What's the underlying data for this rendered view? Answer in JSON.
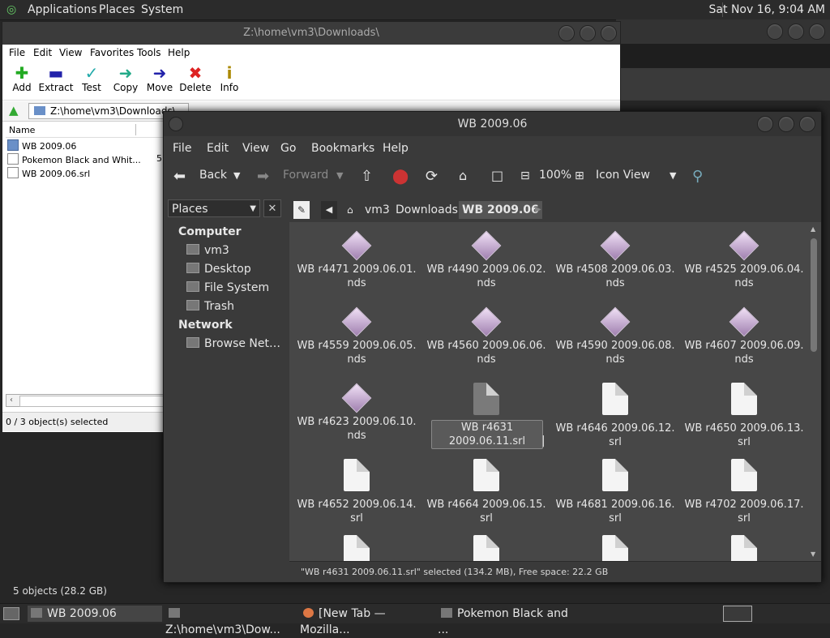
{
  "top_panel": {
    "menus": [
      "Applications",
      "Places",
      "System"
    ],
    "clock": "Sat Nov 16,  9:04 AM"
  },
  "zip_window": {
    "title": "Z:\\home\\vm3\\Downloads\\",
    "menus": [
      "File",
      "Edit",
      "View",
      "Favorites",
      "Tools",
      "Help"
    ],
    "toolbar": [
      {
        "label": "Add",
        "icon": "add-icon"
      },
      {
        "label": "Extract",
        "icon": "extract-icon"
      },
      {
        "label": "Test",
        "icon": "test-icon"
      },
      {
        "label": "Copy",
        "icon": "copy-icon"
      },
      {
        "label": "Move",
        "icon": "move-icon"
      },
      {
        "label": "Delete",
        "icon": "delete-icon"
      },
      {
        "label": "Info",
        "icon": "info-icon"
      }
    ],
    "address": "Z:\\home\\vm3\\Downloads\\",
    "column_name": "Name",
    "rows": [
      {
        "name": "WB 2009.06",
        "type": "folder"
      },
      {
        "name": "Pokemon Black and Whit...",
        "type": "file",
        "extra": "5"
      },
      {
        "name": "WB 2009.06.srl",
        "type": "file"
      }
    ],
    "status": "0 / 3 object(s) selected"
  },
  "fm_window": {
    "title": "WB 2009.06",
    "menus": [
      "File",
      "Edit",
      "View",
      "Go",
      "Bookmarks",
      "Help"
    ],
    "toolbar": {
      "back": "Back",
      "forward": "Forward",
      "zoom": "100%",
      "view_mode": "Icon View"
    },
    "sidebar": {
      "selector": "Places",
      "sections": [
        {
          "heading": "Computer",
          "items": [
            "vm3",
            "Desktop",
            "File System",
            "Trash"
          ]
        },
        {
          "heading": "Network",
          "items": [
            "Browse Net…"
          ]
        }
      ]
    },
    "path": [
      "vm3",
      "Downloads",
      "WB 2009.06"
    ],
    "files": [
      {
        "line1": "WB r4471 2009.06.01.",
        "line2": "nds",
        "kind": "nds"
      },
      {
        "line1": "WB r4490 2009.06.02.",
        "line2": "nds",
        "kind": "nds"
      },
      {
        "line1": "WB r4508 2009.06.03.",
        "line2": "nds",
        "kind": "nds"
      },
      {
        "line1": "WB r4525 2009.06.04.",
        "line2": "nds",
        "kind": "nds"
      },
      {
        "line1": "WB r4559 2009.06.05.",
        "line2": "nds",
        "kind": "nds"
      },
      {
        "line1": "WB r4560 2009.06.06.",
        "line2": "nds",
        "kind": "nds"
      },
      {
        "line1": "WB r4590 2009.06.08.",
        "line2": "nds",
        "kind": "nds"
      },
      {
        "line1": "WB r4607 2009.06.09.",
        "line2": "nds",
        "kind": "nds"
      },
      {
        "line1": "WB r4623 2009.06.10.",
        "line2": "nds",
        "kind": "nds"
      },
      {
        "line1": "WB r4631",
        "line2": "2009.06.11.srl",
        "kind": "srl-selected"
      },
      {
        "line1": "WB r4646 2009.06.12.",
        "line2": "srl",
        "kind": "srl"
      },
      {
        "line1": "WB r4650 2009.06.13.",
        "line2": "srl",
        "kind": "srl"
      },
      {
        "line1": "WB r4652 2009.06.14.",
        "line2": "srl",
        "kind": "srl"
      },
      {
        "line1": "WB r4664 2009.06.15.",
        "line2": "srl",
        "kind": "srl"
      },
      {
        "line1": "WB r4681 2009.06.16.",
        "line2": "srl",
        "kind": "srl"
      },
      {
        "line1": "WB r4702 2009.06.17.",
        "line2": "srl",
        "kind": "srl"
      }
    ],
    "status": "\"WB r4631 2009.06.11.srl\" selected (134.2 MB), Free space: 22.2 GB"
  },
  "desktop_status": "5 objects (28.2 GB)",
  "taskbar": [
    {
      "label": "WB 2009.06",
      "active": true
    },
    {
      "label": "Z:\\home\\vm3\\Dow...",
      "active": false
    },
    {
      "label": "[New Tab — Mozilla...",
      "active": false
    },
    {
      "label": "Pokemon Black and ...",
      "active": false
    }
  ]
}
